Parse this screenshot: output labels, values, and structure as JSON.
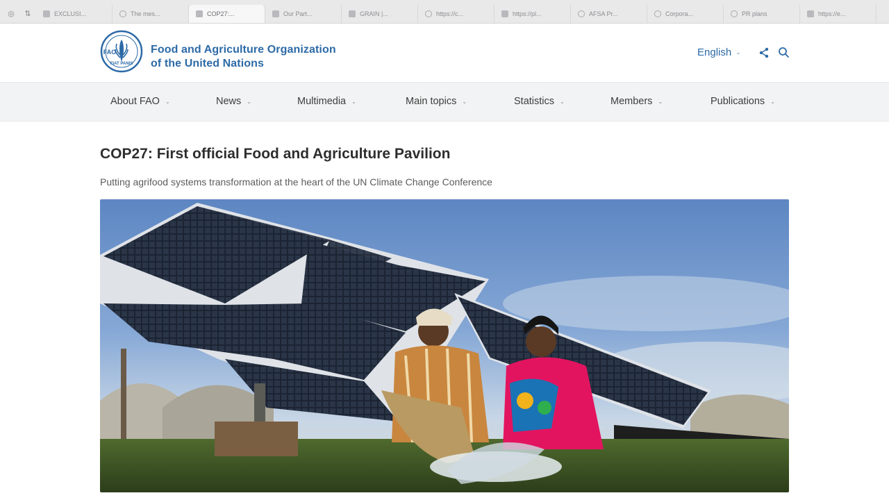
{
  "browser": {
    "tabs": [
      {
        "label": "EXCLUSI...",
        "icon": "page-icon"
      },
      {
        "label": "The mes...",
        "icon": "globe-icon"
      },
      {
        "label": "COP27:...",
        "icon": "page-icon",
        "active": true
      },
      {
        "label": "Our Part...",
        "icon": "page-icon"
      },
      {
        "label": "GRAIN |...",
        "icon": "page-icon"
      },
      {
        "label": "https://c...",
        "icon": "wordpress-icon"
      },
      {
        "label": "https://pl...",
        "icon": "page-icon"
      },
      {
        "label": "AFSA Pr...",
        "icon": "wordpress-icon"
      },
      {
        "label": "Corpora...",
        "icon": "globe-icon"
      },
      {
        "label": "PR plans",
        "icon": "circle-icon"
      },
      {
        "label": "https://e...",
        "icon": "page-icon"
      }
    ]
  },
  "header": {
    "org_line1": "Food and Agriculture Organization",
    "org_line2": "of the United Nations",
    "logo_text": "FAO",
    "language": "English",
    "brand_color": "#2c6aa6"
  },
  "nav": {
    "items": [
      {
        "label": "About FAO"
      },
      {
        "label": "News"
      },
      {
        "label": "Multimedia"
      },
      {
        "label": "Main topics"
      },
      {
        "label": "Statistics"
      },
      {
        "label": "Members"
      },
      {
        "label": "Publications"
      }
    ]
  },
  "article": {
    "title": "COP27: First official Food and Agriculture Pavilion",
    "subtitle": "Putting agrifood systems transformation at the heart of the UN Climate Change Conference",
    "hero_image": "solar-panels-farmers-photo"
  }
}
